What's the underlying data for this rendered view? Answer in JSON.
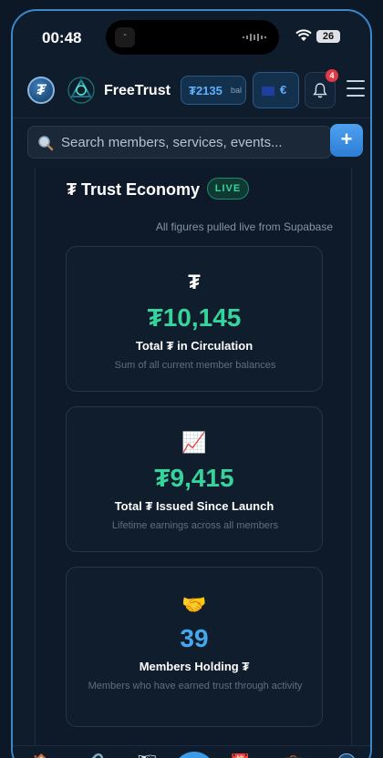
{
  "status": {
    "time": "00:48",
    "battery": "26"
  },
  "header": {
    "logo_letter": "₮",
    "brand": "FreeTrust",
    "balance": "₮2135",
    "balance_label": "bal",
    "currency": "€",
    "notifications": "4"
  },
  "search": {
    "placeholder": "Search members, services, events...",
    "add_label": "+"
  },
  "section": {
    "title": "₮ Trust Economy",
    "live": "LIVE",
    "subtitle": "All figures pulled live from Supabase"
  },
  "cards": [
    {
      "icon": "₮",
      "value": "₮10,145",
      "title": "Total ₮ in Circulation",
      "desc": "Sum of all current member balances",
      "accent": "#36d39a"
    },
    {
      "icon": "📈",
      "value": "₮9,415",
      "title": "Total ₮ Issued Since Launch",
      "desc": "Lifetime earnings across all members",
      "accent": "#36d39a"
    },
    {
      "icon": "🤝",
      "value": "39",
      "title": "Members Holding ₮",
      "desc": "Members who have earned trust through activity",
      "accent": "#45a8ee"
    }
  ],
  "bottom_nav": {
    "icons": [
      "home-icon",
      "link-icon",
      "map-icon",
      "create-icon",
      "calendar-icon",
      "briefcase-icon",
      "trust-icon"
    ]
  }
}
